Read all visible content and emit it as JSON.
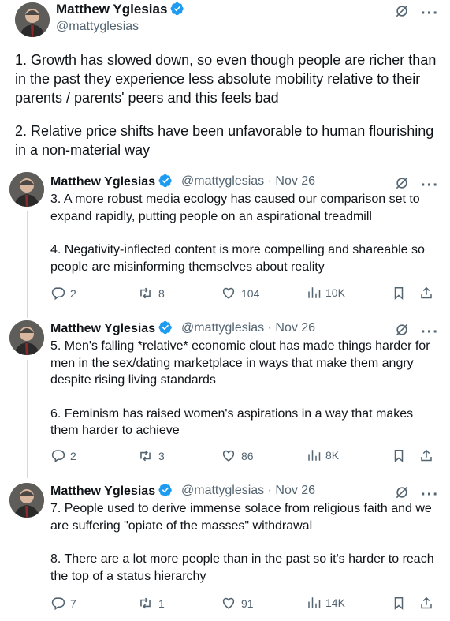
{
  "main_tweet": {
    "author_name": "Matthew Yglesias",
    "handle": "@mattyglesias",
    "paragraphs": [
      "1. Growth has slowed down, so even though people are richer than in the past they experience less absolute mobility relative to their parents / parents' peers and this feels bad",
      "2. Relative price shifts have been unfavorable to human flourishing in a non-material way"
    ]
  },
  "replies": [
    {
      "author_name": "Matthew Yglesias",
      "handle_date": "@mattyglesias · Nov 26",
      "paragraphs": [
        "3. A more robust media ecology has caused our comparison set to expand rapidly, putting people on an aspirational treadmill",
        "4. Negativity-inflected content is more compelling and shareable so people are misinforming themselves about reality"
      ],
      "replies_count": "2",
      "retweets_count": "8",
      "likes_count": "104",
      "views_count": "10K"
    },
    {
      "author_name": "Matthew Yglesias",
      "handle_date": "@mattyglesias · Nov 26",
      "paragraphs": [
        "5. Men's falling *relative* economic clout has made things harder for men in the sex/dating marketplace in ways that make them angry despite rising living standards",
        "6. Feminism has raised women's aspirations in a way that makes them harder to achieve"
      ],
      "replies_count": "2",
      "retweets_count": "3",
      "likes_count": "86",
      "views_count": "8K"
    },
    {
      "author_name": "Matthew Yglesias",
      "handle_date": "@mattyglesias · Nov 26",
      "paragraphs": [
        "7. People used to derive immense solace from religious faith and we are suffering \"opiate of the masses\" withdrawal",
        "8. There are a lot more people than in the past so it's harder to reach the top of a status hierarchy"
      ],
      "replies_count": "7",
      "retweets_count": "1",
      "likes_count": "91",
      "views_count": "14K"
    }
  ],
  "icons": {
    "verified": "verified-badge-icon",
    "grok": "grok-icon",
    "more": "more-icon",
    "reply": "reply-icon",
    "retweet": "retweet-icon",
    "like": "like-icon",
    "views": "views-icon",
    "bookmark": "bookmark-icon",
    "share": "share-icon"
  },
  "colors": {
    "verified_blue": "#1d9bf0",
    "text_primary": "#0f1419",
    "text_secondary": "#536471",
    "thread_line": "#cfd9de"
  }
}
